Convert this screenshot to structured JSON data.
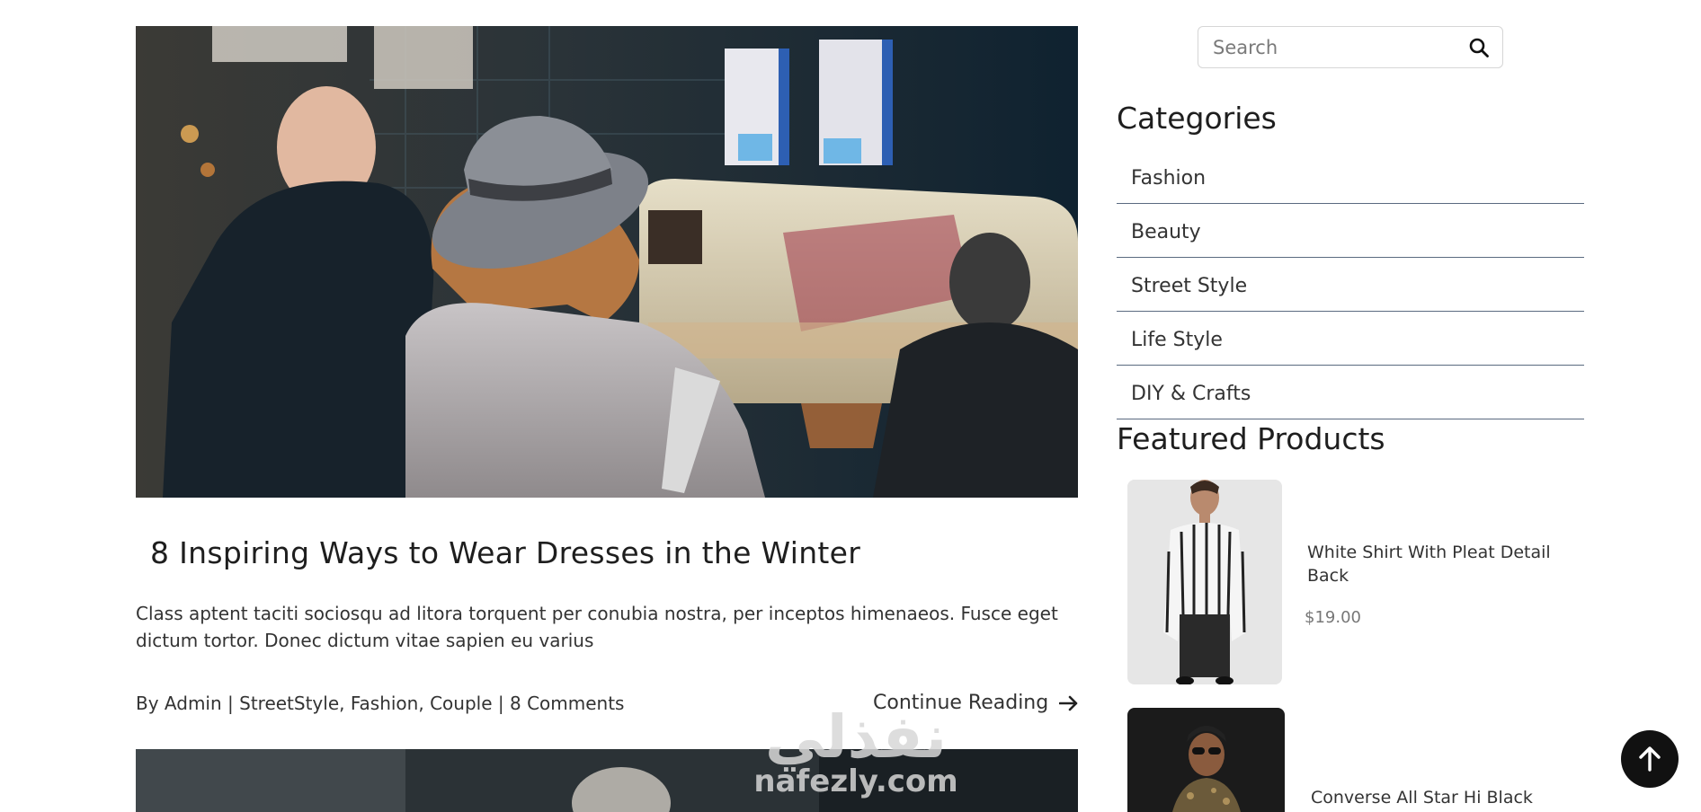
{
  "post": {
    "image_alt": "Couple walking at night market in winter coats",
    "title": "8 Inspiring Ways to Wear Dresses in the Winter",
    "excerpt": "Class aptent taciti sociosqu ad litora torquent per conubia nostra, per inceptos himenaeos. Fusce eget dictum tortor. Donec dictum vitae sapien eu varius",
    "meta": {
      "by": "By Admin",
      "sep1": " | ",
      "tag1": "StreetStyle",
      "tag2": "Fashion",
      "tag3": "Couple",
      "comments": "8 Comments"
    },
    "continue_label": "Continue Reading"
  },
  "sidebar": {
    "search_placeholder": "Search",
    "categories_heading": "Categories",
    "categories": [
      "Fashion",
      "Beauty",
      "Street Style",
      "Life Style",
      "DIY & Crafts"
    ],
    "featured_heading": "Featured Products",
    "products": [
      {
        "name": "White Shirt With Pleat Detail Back",
        "price": "$19.00"
      },
      {
        "name": "Converse All Star Hi Black",
        "price": ""
      }
    ]
  },
  "watermark": {
    "arabic": "نفذلي",
    "latin": "nafezly.com"
  },
  "icons": {
    "search": "search-icon",
    "arrow_right": "arrow-right-icon",
    "arrow_up": "arrow-up-icon"
  }
}
